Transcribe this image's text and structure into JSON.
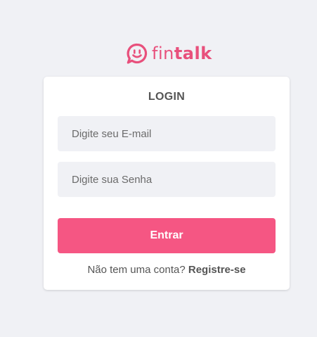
{
  "brand": {
    "name_part1": "fin",
    "name_part2": "talk",
    "color": "#e8507c",
    "icon": "chat-bubble-smile-icon"
  },
  "login": {
    "title": "LOGIN",
    "email_placeholder": "Digite seu E-mail",
    "email_value": "",
    "password_placeholder": "Digite sua Senha",
    "password_value": "",
    "submit_label": "Entrar",
    "submit_color": "#f55683",
    "register_prompt": "Não tem uma conta?",
    "register_link": "Registre-se"
  },
  "colors": {
    "background": "#f0f1f5",
    "card": "#ffffff",
    "text": "#555555"
  }
}
